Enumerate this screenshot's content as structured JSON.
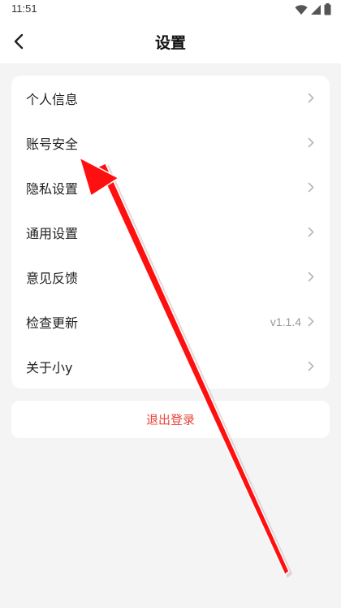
{
  "status_bar": {
    "time": "11:51"
  },
  "nav": {
    "title": "设置",
    "back_icon": "chevron-left-icon"
  },
  "menu": {
    "items": [
      {
        "label": "个人信息",
        "value": ""
      },
      {
        "label": "账号安全",
        "value": ""
      },
      {
        "label": "隐私设置",
        "value": ""
      },
      {
        "label": "通用设置",
        "value": ""
      },
      {
        "label": "意见反馈",
        "value": ""
      },
      {
        "label": "检查更新",
        "value": "v1.1.4"
      },
      {
        "label": "关于小y",
        "value": ""
      }
    ]
  },
  "logout": {
    "label": "退出登录",
    "color": "#e8443a"
  },
  "annotation": {
    "arrow_color": "#ff0000",
    "target": "账号安全"
  },
  "colors": {
    "background": "#f4f4f5",
    "card": "#ffffff",
    "text": "#222222",
    "secondary_text": "#999999",
    "chevron": "#b5b5b5"
  }
}
